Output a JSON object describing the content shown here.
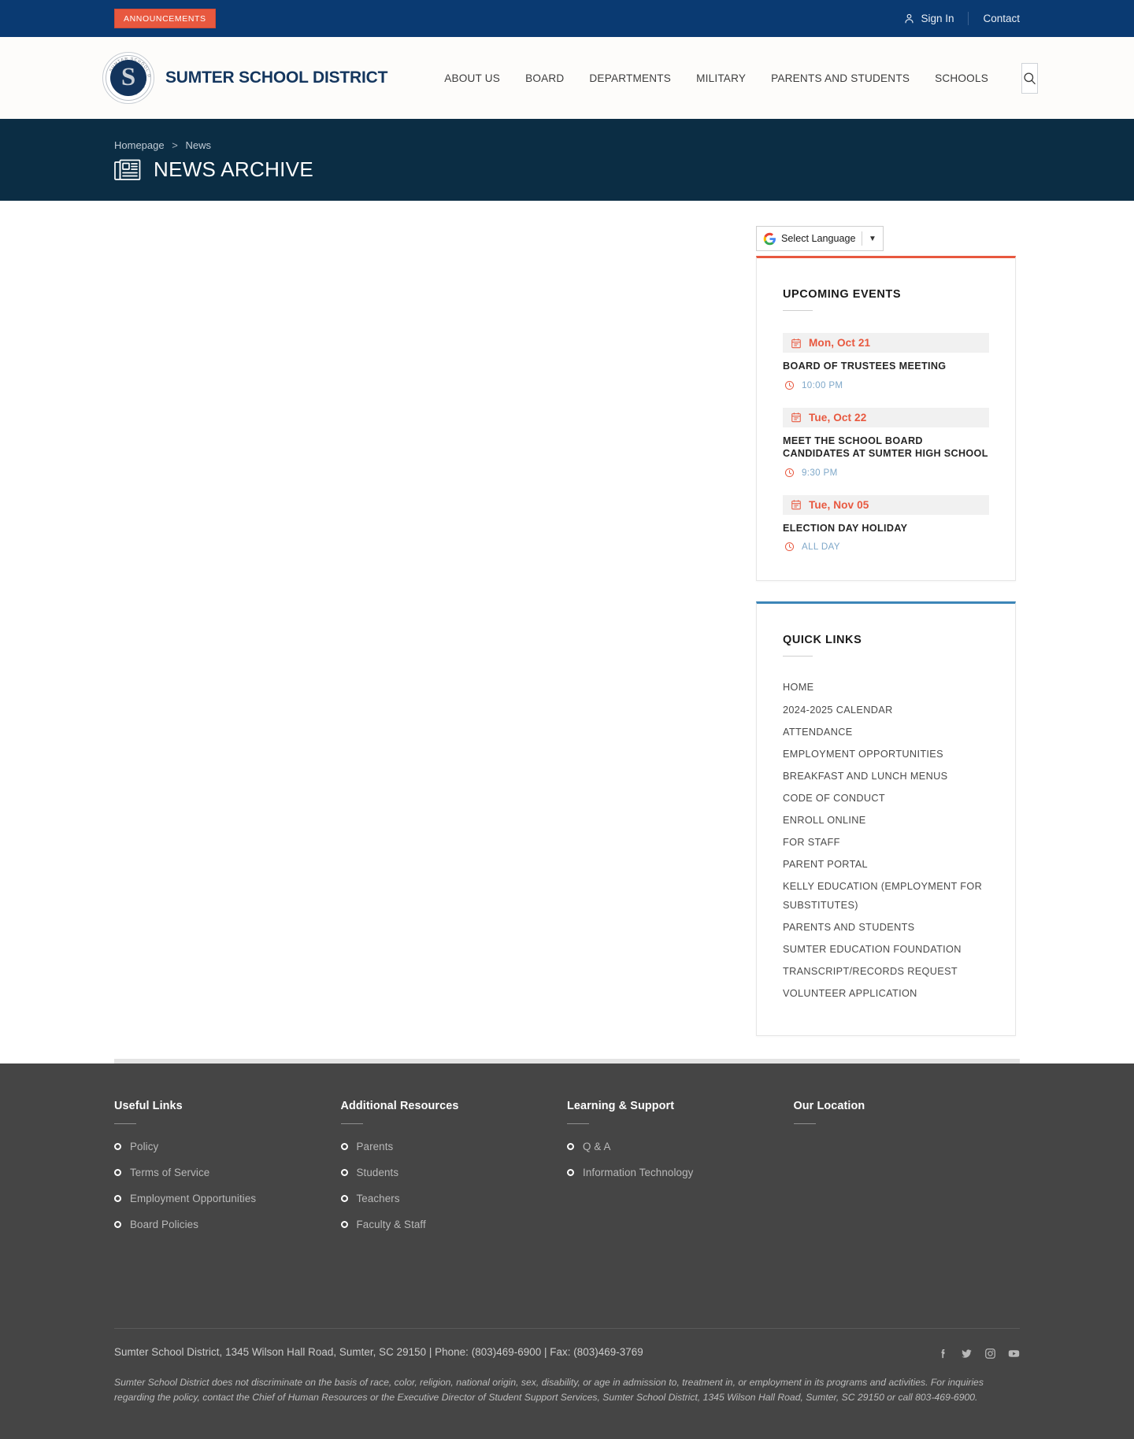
{
  "topbar": {
    "announcements_label": "ANNOUNCEMENTS",
    "signin_label": "Sign In",
    "contact_label": "Contact"
  },
  "header": {
    "brand_name": "SUMTER SCHOOL DISTRICT",
    "logo_letter": "S",
    "nav": [
      {
        "label": "ABOUT US"
      },
      {
        "label": "BOARD"
      },
      {
        "label": "DEPARTMENTS"
      },
      {
        "label": "MILITARY"
      },
      {
        "label": "PARENTS AND STUDENTS"
      },
      {
        "label": "SCHOOLS"
      }
    ]
  },
  "banner": {
    "breadcrumb_home": "Homepage",
    "breadcrumb_sep": ">",
    "breadcrumb_current": "News",
    "title": "NEWS ARCHIVE"
  },
  "translate": {
    "label": "Select Language",
    "caret": "▼"
  },
  "events": {
    "title": "UPCOMING EVENTS",
    "items": [
      {
        "date": "Mon, Oct 21",
        "name": "BOARD OF TRUSTEES MEETING",
        "time": "10:00 PM"
      },
      {
        "date": "Tue, Oct 22",
        "name": "MEET THE SCHOOL BOARD CANDIDATES AT SUMTER HIGH SCHOOL",
        "time": "9:30 PM"
      },
      {
        "date": "Tue, Nov 05",
        "name": "ELECTION DAY HOLIDAY",
        "time": "ALL DAY"
      }
    ]
  },
  "quick_links": {
    "title": "QUICK LINKS",
    "items": [
      {
        "label": "HOME"
      },
      {
        "label": "2024-2025 CALENDAR"
      },
      {
        "label": "ATTENDANCE"
      },
      {
        "label": "EMPLOYMENT OPPORTUNITIES"
      },
      {
        "label": "BREAKFAST AND LUNCH MENUS"
      },
      {
        "label": "CODE OF CONDUCT"
      },
      {
        "label": "ENROLL ONLINE"
      },
      {
        "label": "FOR STAFF"
      },
      {
        "label": "PARENT PORTAL"
      },
      {
        "label": "KELLY EDUCATION (EMPLOYMENT FOR SUBSTITUTES)"
      },
      {
        "label": "PARENTS AND STUDENTS"
      },
      {
        "label": "SUMTER EDUCATION FOUNDATION"
      },
      {
        "label": "TRANSCRIPT/RECORDS REQUEST"
      },
      {
        "label": "VOLUNTEER APPLICATION"
      }
    ]
  },
  "footer": {
    "columns": [
      {
        "title": "Useful Links",
        "links": [
          {
            "label": "Policy"
          },
          {
            "label": "Terms of Service"
          },
          {
            "label": "Employment Opportunities"
          },
          {
            "label": "Board Policies"
          }
        ]
      },
      {
        "title": "Additional Resources",
        "links": [
          {
            "label": "Parents"
          },
          {
            "label": "Students"
          },
          {
            "label": "Teachers"
          },
          {
            "label": "Faculty & Staff"
          }
        ]
      },
      {
        "title": "Learning & Support",
        "links": [
          {
            "label": "Q & A"
          },
          {
            "label": "Information Technology"
          }
        ]
      },
      {
        "title": "Our Location",
        "links": []
      }
    ],
    "address": "Sumter School District, 1345 Wilson Hall Road, Sumter, SC 29150 | Phone: (803)469-6900 | Fax: (803)469-3769",
    "disclaimer": "Sumter School District does not discriminate on the basis of race, color, religion, national origin, sex, disability, or age in admission to, treatment in, or employment in its programs and activities. For inquiries regarding the policy, contact the Chief of Human Resources or the Executive Director of Student Support Services, Sumter School District, 1345 Wilson Hall Road, Sumter, SC 29150 or call 803-469-6900.",
    "socials": [
      {
        "name": "facebook-icon"
      },
      {
        "name": "twitter-icon"
      },
      {
        "name": "instagram-icon"
      },
      {
        "name": "youtube-icon"
      }
    ]
  },
  "colors": {
    "topbar_blue": "#0a3a72",
    "banner_navy": "#0b2d44",
    "accent_red": "#e8583f",
    "accent_blue": "#3d86b8",
    "footer_gray": "#454545",
    "brand_navy": "#14365e"
  }
}
